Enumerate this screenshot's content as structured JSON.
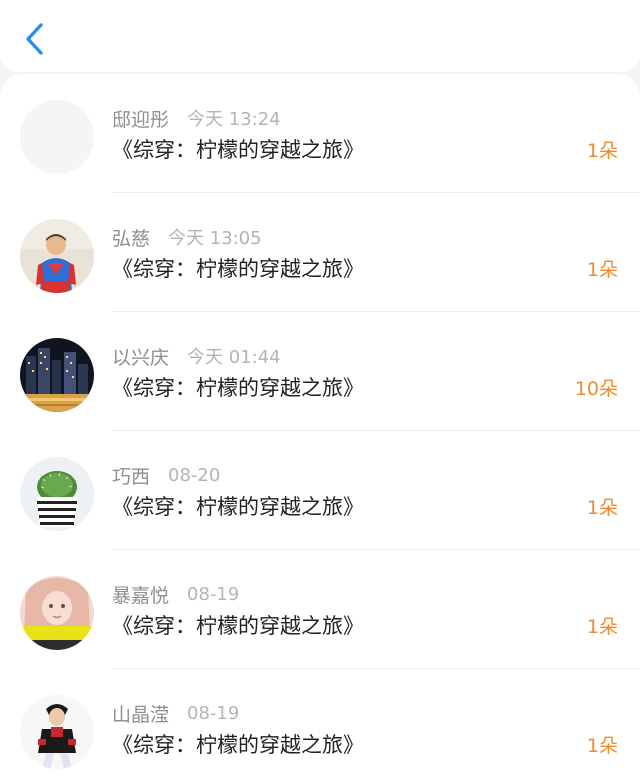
{
  "header": {
    "back_icon": "chevron-left-icon",
    "accent_color": "#2d8cf0"
  },
  "rows": [
    {
      "name": "邸迎彤",
      "time": "今天 13:24",
      "title": "《综穿：柠檬的穿越之旅》",
      "count": "1朵",
      "avatar": "blank-avatar"
    },
    {
      "name": "弘慈",
      "time": "今天 13:05",
      "title": "《综穿：柠檬的穿越之旅》",
      "count": "1朵",
      "avatar": "child-superhero-avatar"
    },
    {
      "name": "以兴庆",
      "time": "今天 01:44",
      "title": "《综穿：柠檬的穿越之旅》",
      "count": "10朵",
      "avatar": "city-night-avatar"
    },
    {
      "name": "巧西",
      "time": "08-20",
      "title": "《综穿：柠檬的穿越之旅》",
      "count": "1朵",
      "avatar": "cactus-pot-avatar"
    },
    {
      "name": "暴嘉悦",
      "time": "08-19",
      "title": "《综穿：柠檬的穿越之旅》",
      "count": "1朵",
      "avatar": "doll-avatar"
    },
    {
      "name": "山晶滢",
      "time": "08-19",
      "title": "《综穿：柠檬的穿越之旅》",
      "count": "1朵",
      "avatar": "anime-character-avatar"
    }
  ],
  "colors": {
    "count": "#f08a2c",
    "name": "#8f8f8f",
    "time": "#b4b4b4",
    "title": "#222222"
  }
}
